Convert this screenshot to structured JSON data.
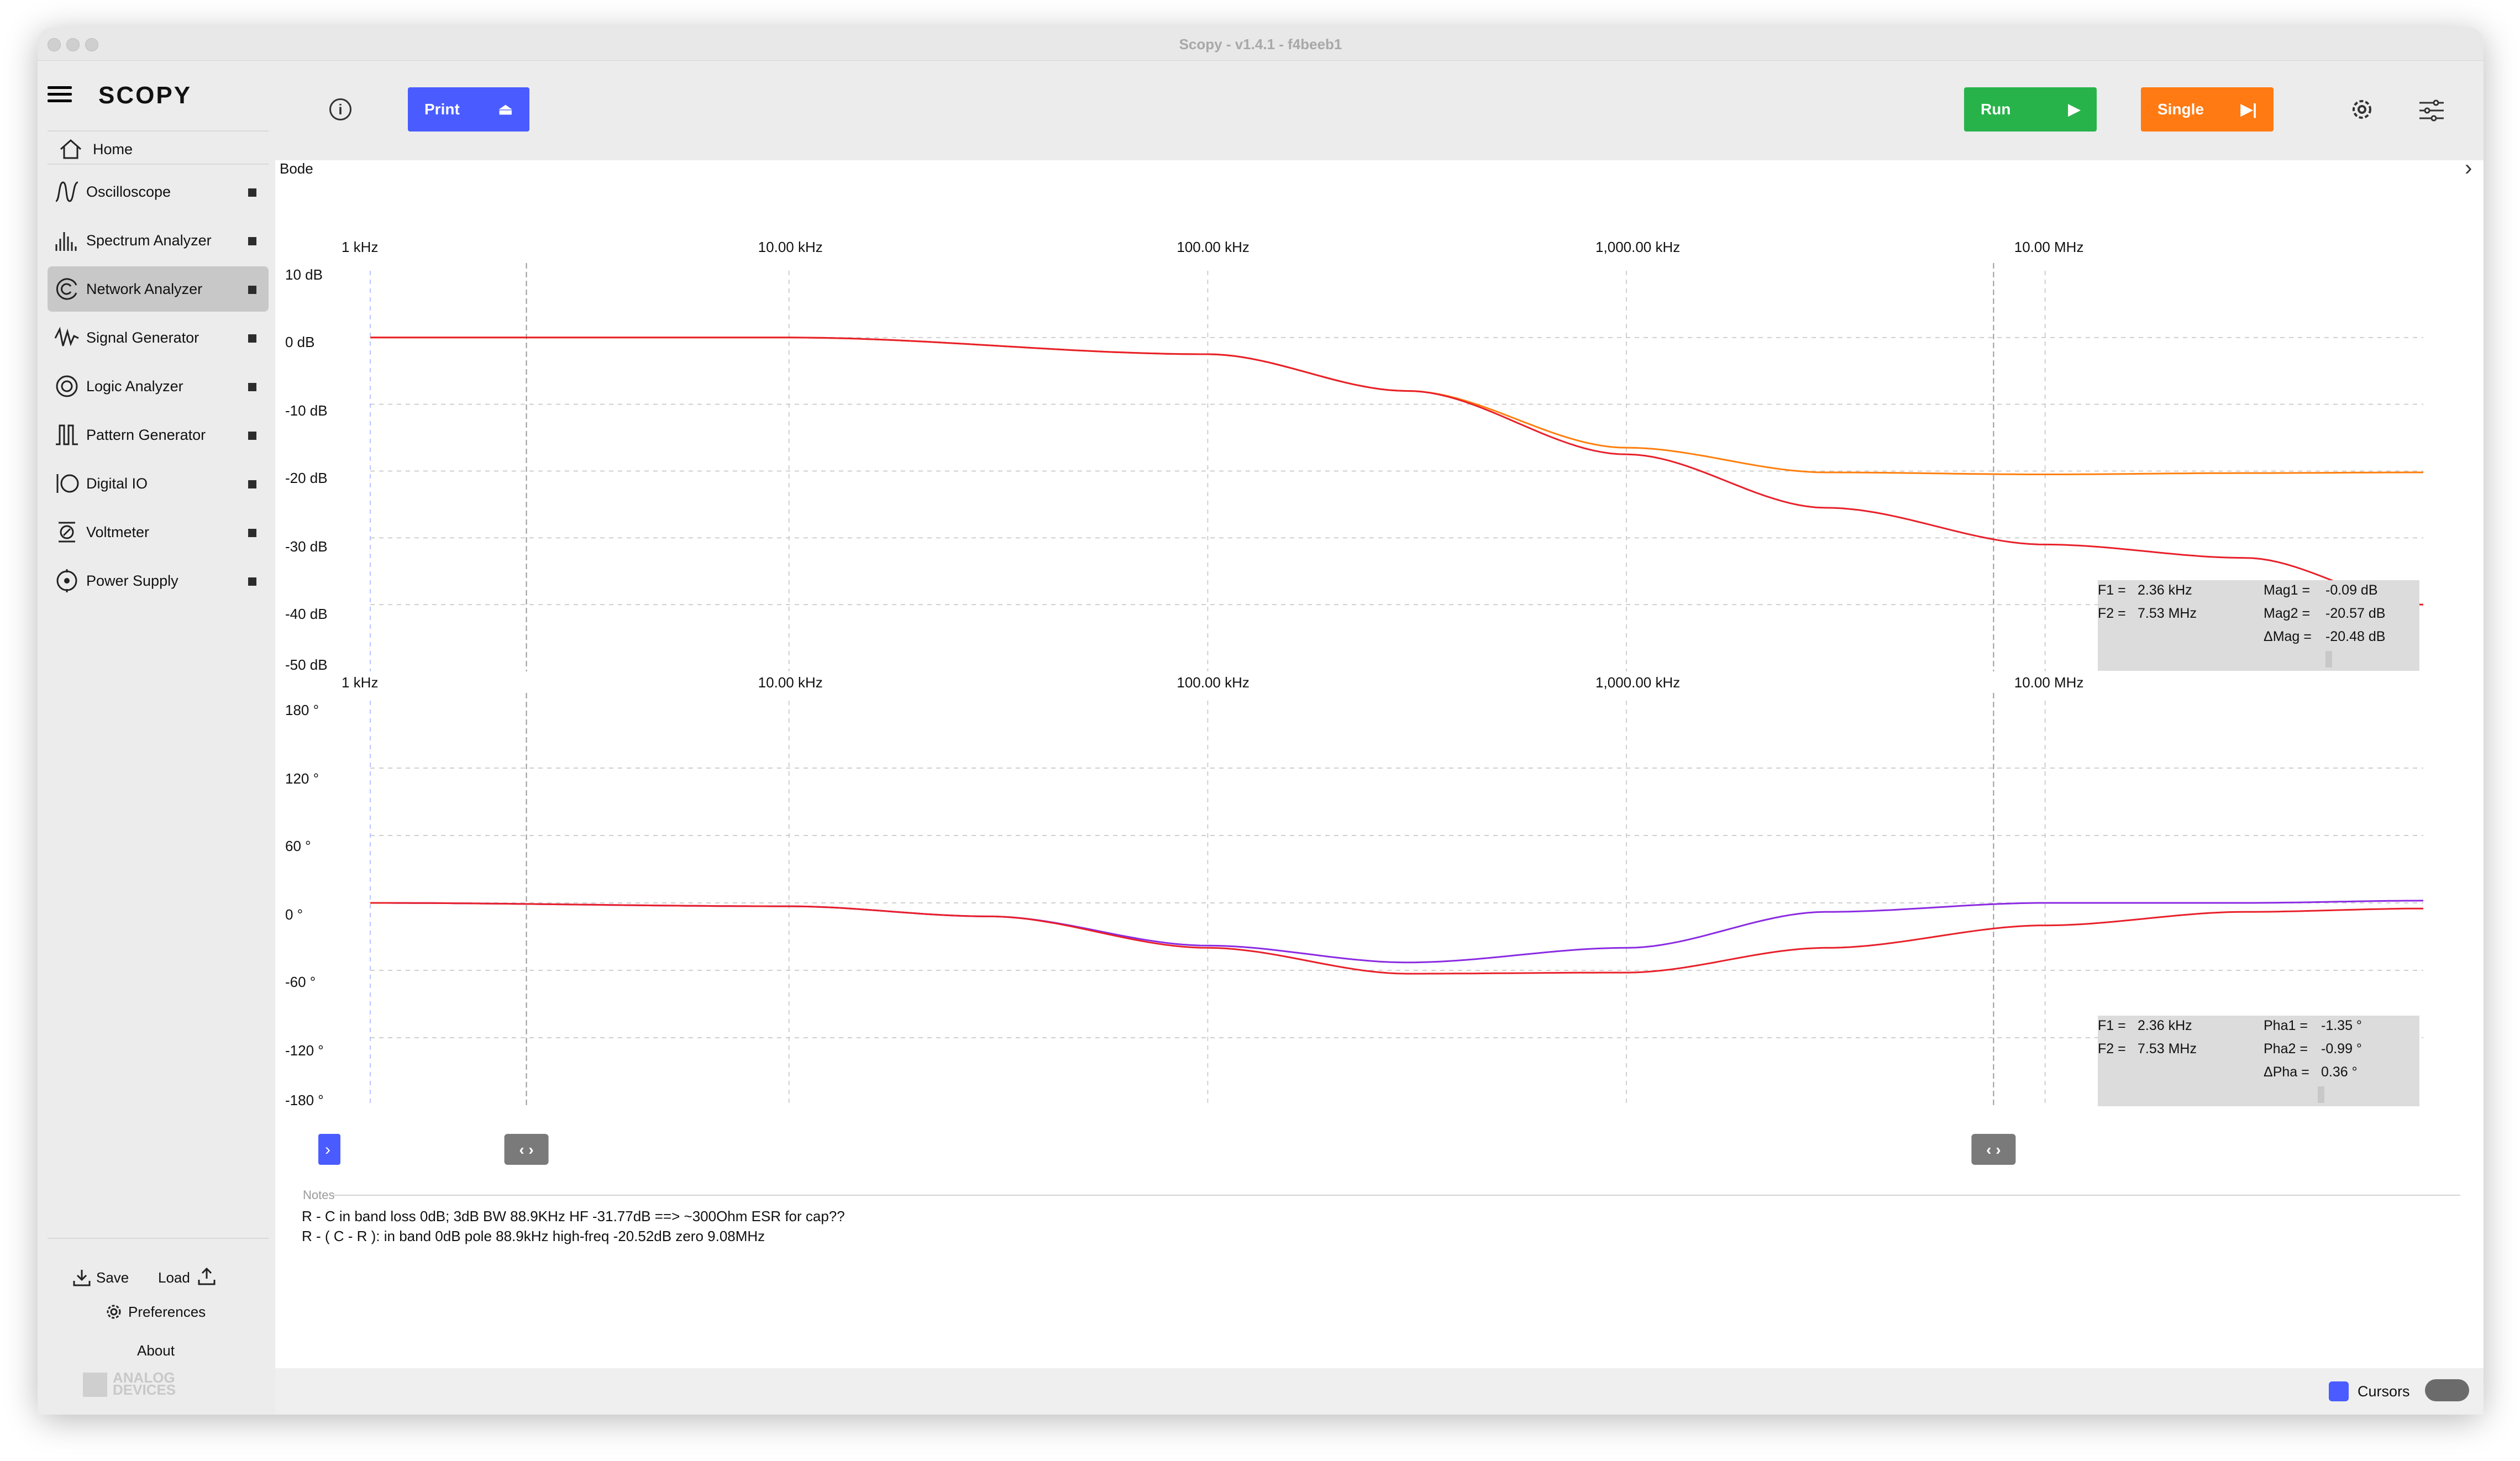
{
  "window": {
    "title": "Scopy - v1.4.1 - f4beeb1"
  },
  "sidebar": {
    "logo": "SCOPY",
    "home_label": "Home",
    "items": [
      {
        "label": "Oscilloscope",
        "icon": "oscilloscope-icon"
      },
      {
        "label": "Spectrum Analyzer",
        "icon": "spectrum-icon"
      },
      {
        "label": "Network Analyzer",
        "icon": "network-analyzer-icon",
        "active": true
      },
      {
        "label": "Signal Generator",
        "icon": "signal-generator-icon"
      },
      {
        "label": "Logic Analyzer",
        "icon": "logic-analyzer-icon"
      },
      {
        "label": "Pattern Generator",
        "icon": "pattern-generator-icon"
      },
      {
        "label": "Digital IO",
        "icon": "digital-io-icon"
      },
      {
        "label": "Voltmeter",
        "icon": "voltmeter-icon"
      },
      {
        "label": "Power Supply",
        "icon": "power-supply-icon"
      }
    ],
    "save_label": "Save",
    "load_label": "Load",
    "preferences_label": "Preferences",
    "about_label": "About",
    "brand_line1": "ANALOG",
    "brand_line2": "DEVICES"
  },
  "toolbar": {
    "print_label": "Print",
    "run_label": "Run",
    "single_label": "Single",
    "colors": {
      "print": "#4a5cff",
      "run": "#27b34a",
      "single": "#ff7a12"
    }
  },
  "plot": {
    "title": "Bode",
    "freq_ticks": [
      "1 kHz",
      "10.00 kHz",
      "100.00 kHz",
      "1,000.00 kHz",
      "10.00 MHz"
    ],
    "mag_ticks": [
      "10 dB",
      "0 dB",
      "-10 dB",
      "-20 dB",
      "-30 dB",
      "-40 dB",
      "-50 dB"
    ],
    "phase_ticks": [
      "180 °",
      "120 °",
      "60 °",
      "0 °",
      "-60 °",
      "-120 °",
      "-180 °"
    ]
  },
  "mag_readout": {
    "f1_label": "F1 =",
    "f1_value": "2.36 kHz",
    "f2_label": "F2 =",
    "f2_value": "7.53 MHz",
    "m1_label": "Mag1 =",
    "m1_value": "-0.09 dB",
    "m2_label": "Mag2 =",
    "m2_value": "-20.57 dB",
    "dm_label": "ΔMag =",
    "dm_value": "-20.48 dB"
  },
  "phase_readout": {
    "f1_label": "F1 =",
    "f1_value": "2.36 kHz",
    "f2_label": "F2 =",
    "f2_value": "7.53 MHz",
    "p1_label": "Pha1 =",
    "p1_value": "-1.35 °",
    "p2_label": "Pha2 =",
    "p2_value": "-0.99 °",
    "dp_label": "ΔPha =",
    "dp_value": "0.36 °"
  },
  "notes": {
    "title": "Notes",
    "lines": [
      "R - C  in band loss 0dB; 3dB BW 88.9KHz HF -31.77dB ==> ~300Ohm ESR for cap??",
      "R - ( C - R ): in band 0dB pole 88.9kHz high-freq -20.52dB zero 9.08MHz"
    ]
  },
  "statusbar": {
    "cursors_label": "Cursors"
  },
  "chart_data": [
    {
      "type": "line",
      "title": "",
      "xscale": "log",
      "xlim": [
        1000,
        80000000
      ],
      "ylim": [
        -50,
        10
      ],
      "ylabel": "dB",
      "x": [
        1000,
        10000,
        100000,
        300000,
        1000000,
        3000000,
        10000000,
        30000000,
        80000000
      ],
      "series": [
        {
          "color": "#ff7f0e",
          "values": [
            0,
            0,
            -2.5,
            -8,
            -16.5,
            -20.2,
            -20.5,
            -20.3,
            -20.2
          ]
        },
        {
          "color": "#e8202a",
          "values": [
            0,
            0,
            -2.5,
            -8,
            -17.5,
            -25.5,
            -31,
            -33,
            -40
          ]
        }
      ]
    },
    {
      "type": "line",
      "title": "",
      "xscale": "log",
      "xlim": [
        1000,
        80000000
      ],
      "ylim": [
        -180,
        180
      ],
      "ylabel": "°",
      "x": [
        1000,
        10000,
        30000,
        100000,
        300000,
        1000000,
        3000000,
        10000000,
        30000000,
        80000000
      ],
      "series": [
        {
          "color": "#8b2be2",
          "values": [
            0,
            -3,
            -12,
            -38,
            -53,
            -40,
            -8,
            0,
            0,
            2
          ]
        },
        {
          "color": "#e8202a",
          "values": [
            0,
            -3,
            -12,
            -40,
            -63,
            -62,
            -40,
            -20,
            -8,
            -5
          ]
        }
      ]
    }
  ]
}
